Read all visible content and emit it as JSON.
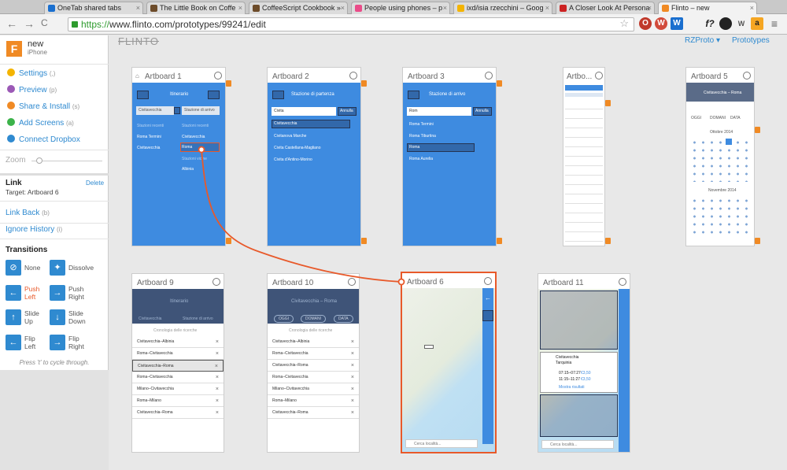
{
  "browser": {
    "tabs": [
      {
        "label": "OneTab shared tabs",
        "color": "#1a6fcf"
      },
      {
        "label": "The Little Book on Coffe",
        "color": "#6d4c2a"
      },
      {
        "label": "CoffeeScript Cookbook »",
        "color": "#6d4c2a"
      },
      {
        "label": "People using phones – p",
        "color": "#ea4c89"
      },
      {
        "label": "ixd/isia rzecchini – Goog",
        "color": "#f4b400"
      },
      {
        "label": "A Closer Look At Persona",
        "color": "#cc2222"
      },
      {
        "label": "Flinto – new",
        "color": "#f08a24"
      }
    ],
    "url_scheme": "https://",
    "url_rest": "www.flinto.com/prototypes/99241/edit",
    "extensions": [
      "O",
      "W",
      "f?",
      "W",
      "a",
      "≡"
    ],
    "nav_back": "←",
    "nav_forward": "→",
    "nav_reload": "C"
  },
  "project": {
    "logo": "F",
    "name": "new",
    "device": "iPhone"
  },
  "menu": [
    {
      "label": "Settings",
      "shortcut": "(,)",
      "color": "#f4b400"
    },
    {
      "label": "Preview",
      "shortcut": "(p)",
      "color": "#9b59b6"
    },
    {
      "label": "Share & Install",
      "shortcut": "(s)",
      "color": "#f08a24"
    },
    {
      "label": "Add Screens",
      "shortcut": "(a)",
      "color": "#3cb34a"
    },
    {
      "label": "Connect Dropbox",
      "shortcut": "",
      "color": "#2f8ad0"
    }
  ],
  "zoom_label": "Zoom",
  "link": {
    "title": "Link",
    "target": "Target: Artboard 6",
    "delete": "Delete",
    "link_back": "Link Back",
    "link_back_sc": "(b)",
    "ignore_history": "Ignore History",
    "ignore_history_sc": "(i)"
  },
  "transitions": {
    "title": "Transitions",
    "items": [
      {
        "label": "None",
        "icon": "⊘"
      },
      {
        "label": "Dissolve",
        "icon": "✦"
      },
      {
        "label": "Push Left",
        "icon": "←",
        "selected": true
      },
      {
        "label": "Push Right",
        "icon": "→"
      },
      {
        "label": "Slide Up",
        "icon": "↑"
      },
      {
        "label": "Slide Down",
        "icon": "↓"
      },
      {
        "label": "Flip Left",
        "icon": "←"
      },
      {
        "label": "Flip Right",
        "icon": "→"
      }
    ],
    "hint": "Press 't' to cycle through."
  },
  "header": {
    "logo": "FLINTO",
    "account": "RZProto ▾",
    "prototypes": "Prototypes"
  },
  "artboards": {
    "a1": {
      "title": "Artboard 1",
      "header": "Itinerario",
      "from": "Civitavecchia",
      "to": "Stazione di arrivo",
      "col1_head": "Stazioni recenti",
      "col2_head": "Stazioni recenti",
      "col1": [
        "Roma Termini",
        "Civitavecchia"
      ],
      "col2": [
        "Civitavecchia",
        "Roma",
        "Stazioni vicine",
        "Albinia"
      ]
    },
    "a2": {
      "title": "Artboard 2",
      "header": "Stazione di partenza",
      "input": "Civita",
      "cancel": "Annulla",
      "rows": [
        "Civitavecchia",
        "Civitanova Marche",
        "Civita Castellana-Magliano",
        "Civita d'Antino-Morino"
      ]
    },
    "a3": {
      "title": "Artboard 3",
      "header": "Stazione di arrivo",
      "input": "Rom",
      "cancel": "Annulla",
      "rows": [
        "Roma Termini",
        "Roma Tiburtina",
        "Roma",
        "Roma Aurelia"
      ]
    },
    "a4": {
      "title": "Artbo..."
    },
    "a5": {
      "title": "Artboard 5",
      "header": "Civitavecchia – Roma",
      "tabs": [
        "OGGI",
        "DOMANI",
        "DATA"
      ],
      "month1": "Ottobre 2014",
      "month2": "Novembre 2014"
    },
    "a9": {
      "title": "Artboard 9",
      "header": "Itinerario",
      "from": "Civitavecchia",
      "to": "Stazione di arrivo",
      "section": "Cronologia delle ricerche",
      "rows": [
        "Civitavecchia–Albinia",
        "Roma–Civitavecchia",
        "Civitavecchia–Roma",
        "Roma–Civitavecchia",
        "Milano–Civitavecchia",
        "Roma–Milano",
        "Civitavecchia–Roma"
      ]
    },
    "a10": {
      "title": "Artboard 10",
      "header": "Civitavecchia – Roma",
      "tabs": [
        "OGGI",
        "DOMANI",
        "DATA"
      ],
      "section": "Cronologia delle ricerche",
      "rows": [
        "Civitavecchia–Albinia",
        "Roma–Civitavecchia",
        "Civitavecchia–Roma",
        "Roma–Civitavecchia",
        "Milano–Civitavecchia",
        "Roma–Milano",
        "Civitavecchia–Roma"
      ]
    },
    "a6": {
      "title": "Artboard 6",
      "search": "Cerca località..."
    },
    "a11": {
      "title": "Artboard 11",
      "search": "Cerca località...",
      "station": "Civitavecchia",
      "station2": "Tarquinia",
      "r1": "07:15–07:27",
      "p1": "€3,50",
      "r2": "11:15–11:27",
      "p2": "€3,50",
      "more": "Mostra risultati"
    }
  },
  "colors": {
    "accent": "#3e8be0",
    "link": "#e8592a",
    "orange": "#f08a24"
  }
}
